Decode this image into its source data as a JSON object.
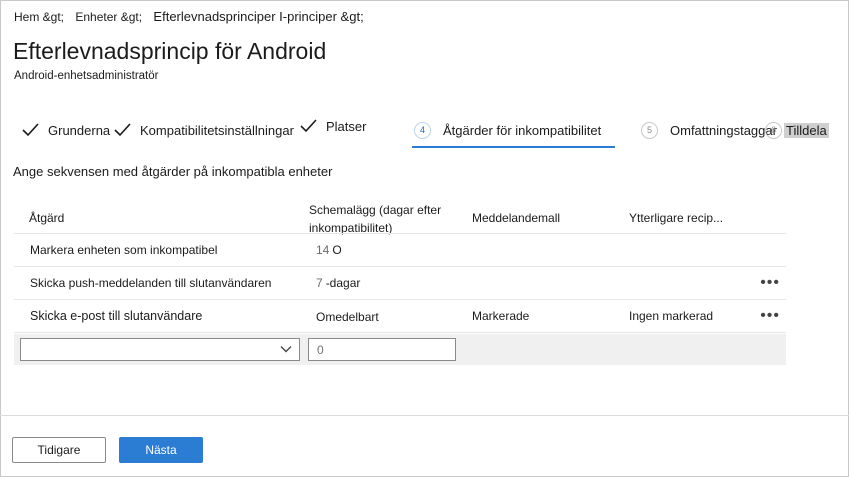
{
  "breadcrumb": {
    "home": "Hem &gt;",
    "devices": "Enheter &gt;",
    "policies": "Efterlevnadsprinciper I-principer &gt;"
  },
  "page": {
    "title": "Efterlevnadsprincip för Android",
    "subtitle": "Android-enhetsadministratör"
  },
  "steps": [
    {
      "label": "Grunderna",
      "state": "done"
    },
    {
      "label": "Kompatibilitetsinställningar",
      "state": "done"
    },
    {
      "label": "Platser",
      "state": "done"
    },
    {
      "number": "4",
      "label": "Åtgärder för inkompatibilitet",
      "state": "active"
    },
    {
      "number": "5",
      "label": "Omfattningstaggar",
      "state": "pending"
    },
    {
      "number": "6",
      "label": "Tilldela",
      "state": "pending"
    }
  ],
  "section_label": "Ange sekvensen med åtgärder på inkompatibla enheter",
  "table": {
    "headers": {
      "action": "Åtgärd",
      "schedule_line1": "Schemalägg (dagar efter",
      "schedule_line2": "inkompatibilitet)",
      "template": "Meddelandemall",
      "recipients": "Ytterligare recip..."
    },
    "rows": [
      {
        "action": "Markera enheten som inkompatibel",
        "schedule_num": "14",
        "schedule_text": "O",
        "template": "",
        "recipients": "",
        "more": ""
      },
      {
        "action": "Skicka push-meddelanden till slutanvändaren",
        "schedule_num": "7",
        "schedule_text": "-dagar",
        "template": "",
        "recipients": "",
        "more": "•••"
      },
      {
        "action": "Skicka e-post till slutanvändare",
        "schedule_num": "",
        "schedule_text": "Omedelbart",
        "template": "Markerade",
        "recipients": "Ingen markerad",
        "more": "•••"
      }
    ],
    "new_row": {
      "select_value": "",
      "days_placeholder": "0"
    }
  },
  "buttons": {
    "previous": "Tidigare",
    "next": "Nästa"
  },
  "colors": {
    "primary": "#2b7cd3",
    "border": "#8a8a8a",
    "add_row_bg": "#f0f0f0"
  }
}
